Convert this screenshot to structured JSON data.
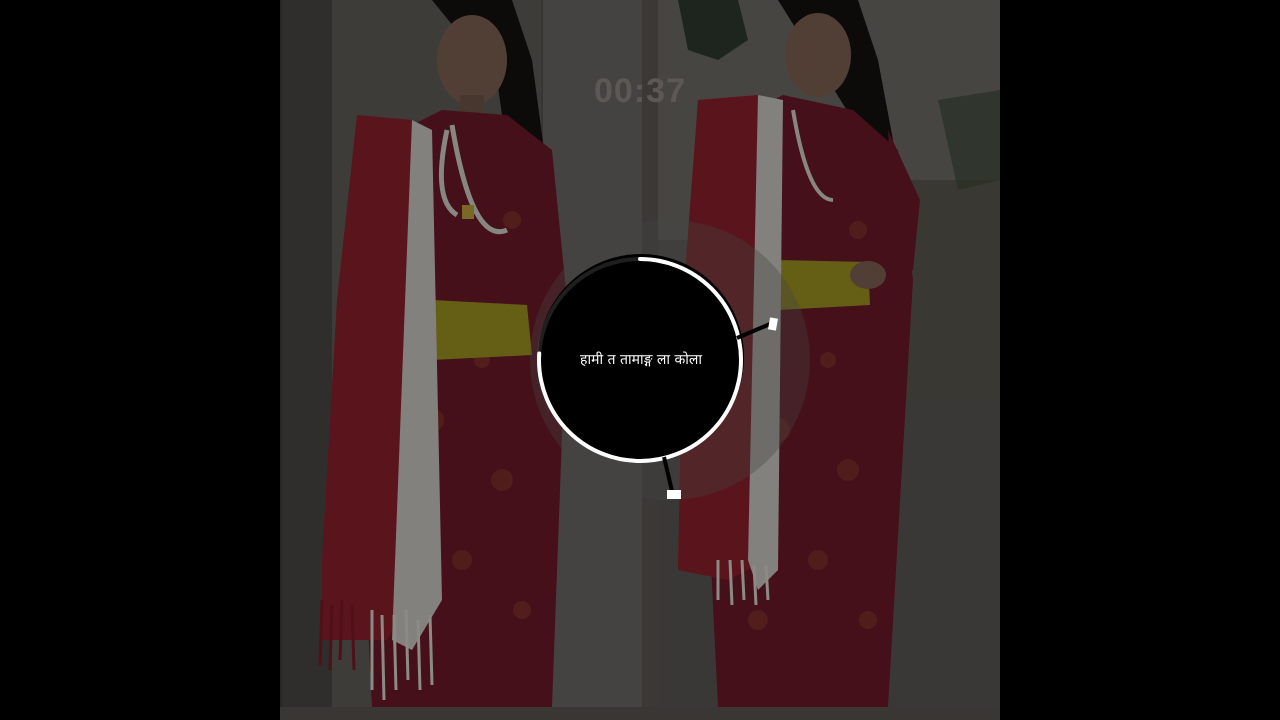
{
  "video": {
    "timer": "00:37",
    "caption": "हामी त तामाङ्ग ला कोला",
    "progress_fraction": 0.76
  },
  "colors": {
    "background": "#000000",
    "dress_red": "#8e1f33",
    "scarf_red": "#b01d2a",
    "scarf_white": "#e8e6e0",
    "belt_yellow": "#c6c21c",
    "wall": "#6a6660",
    "ring": "#ffffff"
  },
  "icons": {
    "timer_handle_top": "tonearm-marker-icon",
    "timer_handle_bottom": "tonearm-marker-icon"
  }
}
